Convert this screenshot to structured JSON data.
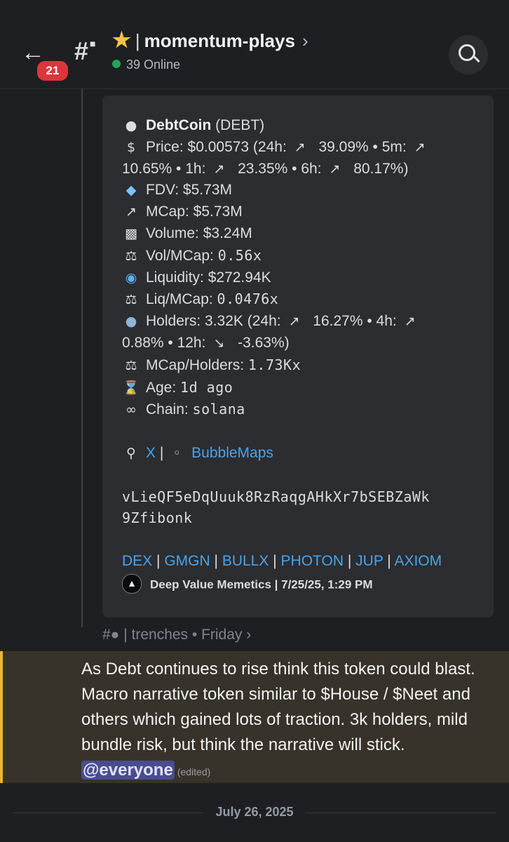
{
  "header": {
    "unread_count": "21",
    "channel_emoji": "★",
    "separator": "|",
    "channel_name": "momentum-plays",
    "online_text": "39 Online"
  },
  "embed": {
    "token_name": "DebtCoin",
    "token_ticker": "(DEBT)",
    "lines": {
      "price_a": "Price: $0.00573 (24h: ",
      "price_b": " 39.09% • 5m: ",
      "price_c": "10.65% • 1h: ",
      "price_d": " 23.35% • 6h: ",
      "price_e": " 80.17%)",
      "fdv": "FDV: $5.73M",
      "mcap": "MCap: $5.73M",
      "volume": "Volume: $3.24M",
      "vol_mcap_label": "Vol/MCap: ",
      "vol_mcap_value": "0.56x",
      "liquidity": "Liquidity: $272.94K",
      "liq_mcap_label": "Liq/MCap: ",
      "liq_mcap_value": "0.0476x",
      "holders_a": "Holders: 3.32K (24h: ",
      "holders_b": " 16.27% • 4h: ",
      "holders_c": "0.88% • 12h: ",
      "holders_d": " -3.63%)",
      "mcap_holders_label": "MCap/Holders: ",
      "mcap_holders_value": "1.73Kx",
      "age_label": "Age: ",
      "age_value": "1d ago",
      "chain_label": "Chain: ",
      "chain_value": "solana"
    },
    "links_row": {
      "x": "X",
      "sep": "|",
      "bubblemaps": "BubbleMaps"
    },
    "address_line1": "vLieQF5eDqUuuk8RzRaqgAHkXr7bSEBZaWk",
    "address_line2": "9Zfibonk",
    "trade_links": [
      "DEX",
      "GMGN",
      "BULLX",
      "PHOTON",
      "JUP",
      "AXIOM"
    ],
    "pipe": "|",
    "footer_text": "Deep Value Memetics | 7/25/25, 1:29 PM"
  },
  "thread": {
    "label": "| trenches • Friday",
    "chevron": "›"
  },
  "message": {
    "text": "As Debt continues to rise think this token could blast. Macro narrative token similar to $House / $Neet and others which gained lots of traction. 3k holders, mild bundle risk, but think the narrative will stick. ",
    "mention": "@everyone",
    "edited": "(edited)"
  },
  "date_divider": "July 26, 2025",
  "icons": {
    "back": "back-arrow-icon",
    "channel": "locked-text-channel-icon",
    "search": "search-icon"
  },
  "colors": {
    "background": "#1e1f22",
    "embed_bg": "#2b2d31",
    "link": "#4aa3e8",
    "badge": "#da373c",
    "online": "#23a55a",
    "highlight_bg": "#38332a",
    "highlight_accent": "#f0b232"
  }
}
